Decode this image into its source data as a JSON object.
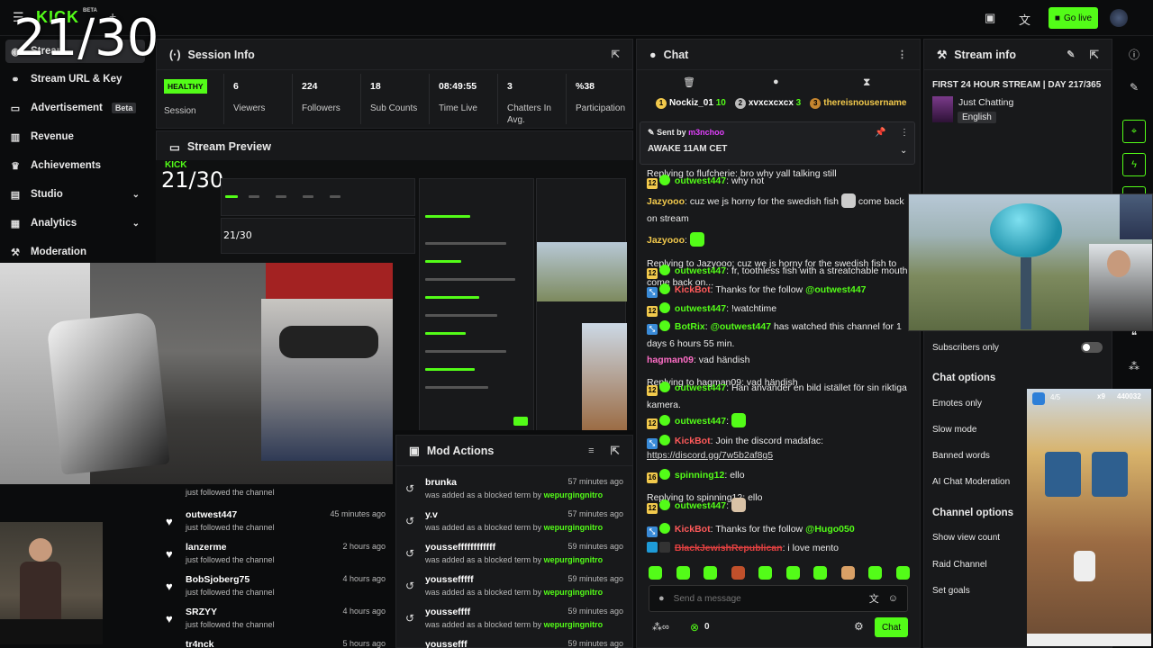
{
  "counter": "21/30",
  "topbar": {
    "logo": "KICK",
    "beta": "BETA",
    "go_live": "Go live"
  },
  "sidebar": {
    "items": [
      {
        "label": "Stream",
        "icon": "stream-icon"
      },
      {
        "label": "Stream URL & Key",
        "icon": "link-icon"
      },
      {
        "label": "Advertisement",
        "icon": "ad-icon",
        "badge": "Beta"
      },
      {
        "label": "Revenue",
        "icon": "revenue-icon"
      },
      {
        "label": "Achievements",
        "icon": "trophy-icon"
      },
      {
        "label": "Studio",
        "icon": "studio-icon"
      },
      {
        "label": "Analytics",
        "icon": "analytics-icon"
      },
      {
        "label": "Moderation",
        "icon": "moderation-icon"
      }
    ]
  },
  "session": {
    "title": "Session Info",
    "health": "HEALTHY",
    "health_label": "Session",
    "stats": [
      {
        "value": "6",
        "label": "Viewers"
      },
      {
        "value": "224",
        "label": "Followers"
      },
      {
        "value": "18",
        "label": "Sub Counts"
      },
      {
        "value": "08:49:55",
        "label": "Time Live"
      },
      {
        "value": "3",
        "label": "Chatters In Avg."
      },
      {
        "value": "%38",
        "label": "Participation"
      }
    ]
  },
  "preview": {
    "title": "Stream Preview",
    "mini_counter": "21/30",
    "mini_counter2": "21/30"
  },
  "followers": [
    {
      "name": "",
      "status": "just followed the channel",
      "time": ""
    },
    {
      "name": "outwest447",
      "status": "just followed the channel",
      "time": "45 minutes ago"
    },
    {
      "name": "lanzerme",
      "status": "just followed the channel",
      "time": "2 hours ago"
    },
    {
      "name": "BobSjoberg75",
      "status": "just followed the channel",
      "time": "4 hours ago"
    },
    {
      "name": "SRZYY",
      "status": "just followed the channel",
      "time": "4 hours ago"
    },
    {
      "name": "tr4nck",
      "status": "",
      "time": "5 hours ago"
    }
  ],
  "mod": {
    "title": "Mod Actions",
    "rows": [
      {
        "term": "brunka",
        "time": "57 minutes ago"
      },
      {
        "term": "y.v",
        "time": "57 minutes ago"
      },
      {
        "term": "yousseffffffffffff",
        "time": "59 minutes ago"
      },
      {
        "term": "youssefffff",
        "time": "59 minutes ago"
      },
      {
        "term": "yousseffff",
        "time": "59 minutes ago"
      },
      {
        "term": "youssefff",
        "time": "59 minutes ago"
      }
    ],
    "action": "was added as a blocked term by",
    "by": "wepurgingnitro"
  },
  "chat": {
    "title": "Chat",
    "leaders": [
      {
        "rank": "1",
        "name": "Nockiz_01",
        "count": "10"
      },
      {
        "rank": "2",
        "name": "xvxcxcxcx",
        "count": "3"
      },
      {
        "rank": "3",
        "name": "thereisnousernamedanyt",
        "count": ""
      }
    ],
    "pinned": {
      "sent_by": "Sent by",
      "user": "m3nchoo",
      "text": "AWAKE 11AM CET"
    },
    "reply1": "Replying to flufcherie: bro why yall talking still",
    "msg1_user": "outwest447",
    "msg1": "why not",
    "msg2_user": "Jazyooo",
    "msg2": "cuz we js horny for the swedish fish",
    "msg2b": "come back on stream",
    "msg3_user": "Jazyooo",
    "reply2": "Replying to Jazyooo: cuz we js horny for the swedish fish to come back on...",
    "msg4_user": "outwest447",
    "msg4": "fr, toothless fish with a streatchable mouth",
    "msg5_user": "KickBot",
    "msg5": "Thanks for the follow",
    "msg5_mention": "@outwest447",
    "msg6_user": "outwest447",
    "msg6": "!watchtime",
    "msg7_user": "BotRix",
    "msg7_mention": "@outwest447",
    "msg7": "has watched this channel for 1 days 6 hours 55 min.",
    "msg8_user": "hagman09",
    "msg8": "vad händish",
    "reply3": "Replying to hagman09: vad händish",
    "msg9_user": "outwest447",
    "msg9": "Han använder en bild istället för sin riktiga kamera.",
    "msg10_user": "outwest447",
    "msg11_user": "KickBot",
    "msg11": "Join the discord madafac:",
    "msg11_link": "https://discord.gg/7w5b2af8g5",
    "msg12_user": "spinning12",
    "msg12": "ello",
    "reply4": "Replying to spinning12: ello",
    "msg13_user": "outwest447",
    "msg14_user": "KickBot",
    "msg14": "Thanks for the follow",
    "msg14_mention": "@Hugo050",
    "msg15_user": "BlackJewishRepublican",
    "msg15": "i love mento",
    "placeholder": "Send a message",
    "count": "0",
    "send": "Chat",
    "badge12": "12",
    "badge16": "16"
  },
  "info": {
    "title": "Stream info",
    "stream_title": "FIRST 24 HOUR STREAM | DAY 217/365",
    "category": "Just Chatting",
    "language": "English",
    "subs_only": "Subscribers only",
    "chat_options": "Chat options",
    "chat_items": [
      "Emotes only",
      "Slow mode",
      "Banned words",
      "AI Chat Moderation"
    ],
    "channel_options": "Channel options",
    "channel_items": [
      "Show view count",
      "Raid Channel",
      "Set goals"
    ]
  },
  "game": {
    "score": "440032",
    "multiplier": "x9",
    "progress": "4/5"
  },
  "colors": {
    "accent": "#53fc18",
    "panel": "#18191b",
    "bg": "#0b0c0d"
  }
}
